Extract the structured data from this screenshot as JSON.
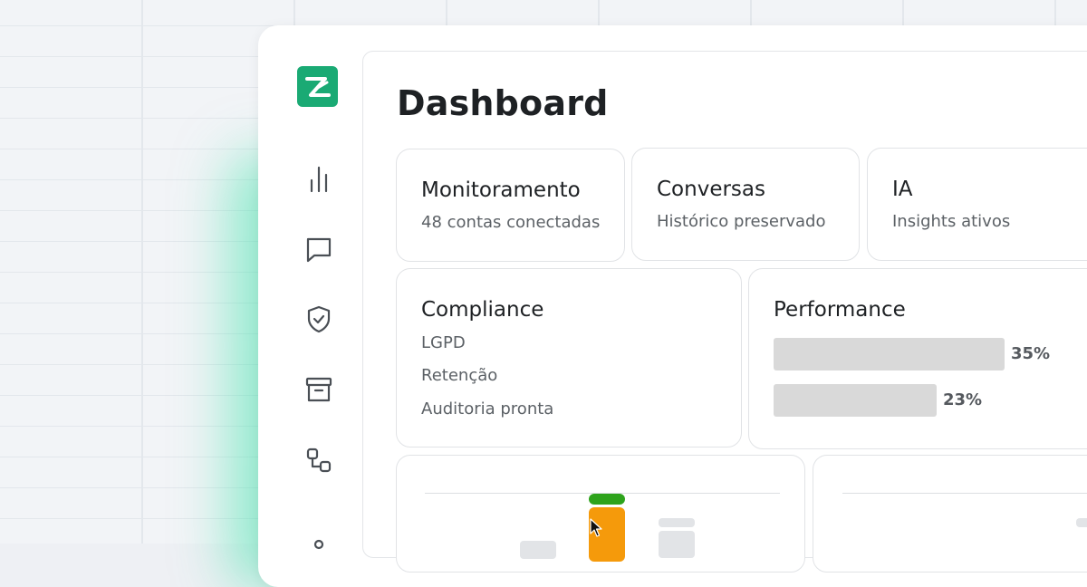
{
  "page_title": "Dashboard",
  "nav": {
    "items": [
      {
        "icon": "bar-chart-icon"
      },
      {
        "icon": "chat-icon"
      },
      {
        "icon": "shield-check-icon"
      },
      {
        "icon": "archive-icon"
      },
      {
        "icon": "workflow-icon"
      }
    ]
  },
  "cards": {
    "monitoramento": {
      "title": "Monitoramento",
      "subtitle": "48 contas conectadas"
    },
    "conversas": {
      "title": "Conversas",
      "subtitle": "Histórico preservado"
    },
    "ia": {
      "title": "IA",
      "subtitle": "Insights ativos"
    },
    "compliance": {
      "title": "Compliance",
      "items": [
        "LGPD",
        "Retenção",
        "Auditoria pronta"
      ]
    },
    "performance": {
      "title": "Performance",
      "bars": [
        {
          "label": "35%",
          "value": 35
        },
        {
          "label": "23%",
          "value": 23
        }
      ]
    }
  },
  "colors": {
    "brand": "#1aaa74",
    "glow": "#3ce1aa",
    "bar_gray": "#d9d9d9",
    "chart_green": "#2ea31c",
    "chart_orange": "#f59a0b"
  }
}
